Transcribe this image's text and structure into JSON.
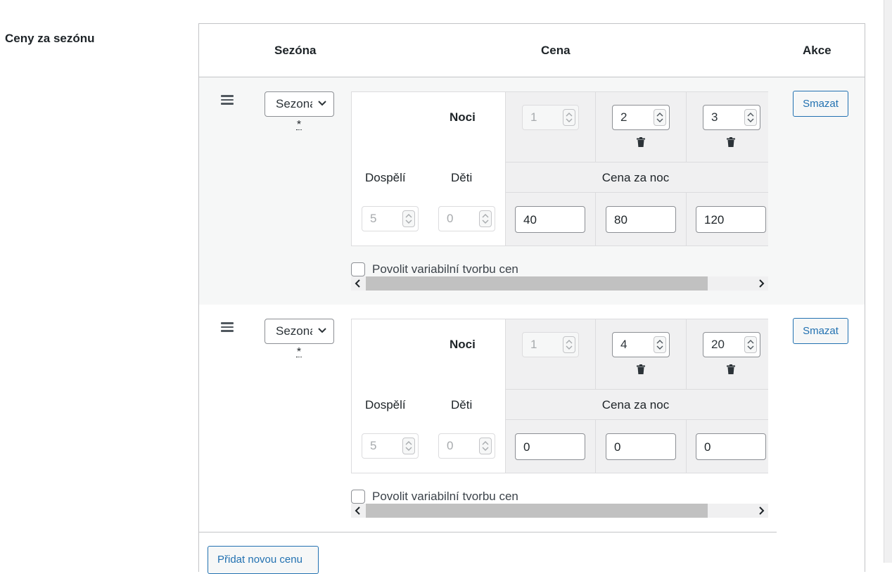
{
  "section_label": "Ceny za sezónu",
  "headers": {
    "season": "Sezóna",
    "price": "Cena",
    "actions": "Akce"
  },
  "rows": [
    {
      "season_select": "Sezona",
      "required_mark": "*",
      "nights_label": "Noci",
      "adults_label": "Dospělí",
      "children_label": "Děti",
      "price_per_night_label": "Cena za noc",
      "adults_value": "5",
      "children_value": "0",
      "nights": [
        "1",
        "2",
        "3"
      ],
      "prices": [
        "40",
        "80",
        "120"
      ],
      "checkbox_label": "Povolit variabilní tvorbu cen",
      "checkbox_checked": false,
      "delete_button": "Smazat"
    },
    {
      "season_select": "Sezona",
      "required_mark": "*",
      "nights_label": "Noci",
      "adults_label": "Dospělí",
      "children_label": "Děti",
      "price_per_night_label": "Cena za noc",
      "adults_value": "5",
      "children_value": "0",
      "nights": [
        "1",
        "4",
        "20"
      ],
      "prices": [
        "0",
        "0",
        "0"
      ],
      "checkbox_label": "Povolit variabilní tvorbu cen",
      "checkbox_checked": false,
      "delete_button": "Smazat"
    }
  ],
  "add_button": "Přidat novou cenu",
  "icons": {
    "drag": "drag-handle-icon",
    "chevron": "chevron-down-icon",
    "trash": "trash-icon",
    "spin": "spinner-arrows-icon",
    "scroll_left": "scroll-left-icon",
    "scroll_right": "scroll-right-icon"
  },
  "colors": {
    "accent": "#2271b1",
    "border": "#c3c4c7",
    "row_alt_bg": "#f6f7f7"
  }
}
